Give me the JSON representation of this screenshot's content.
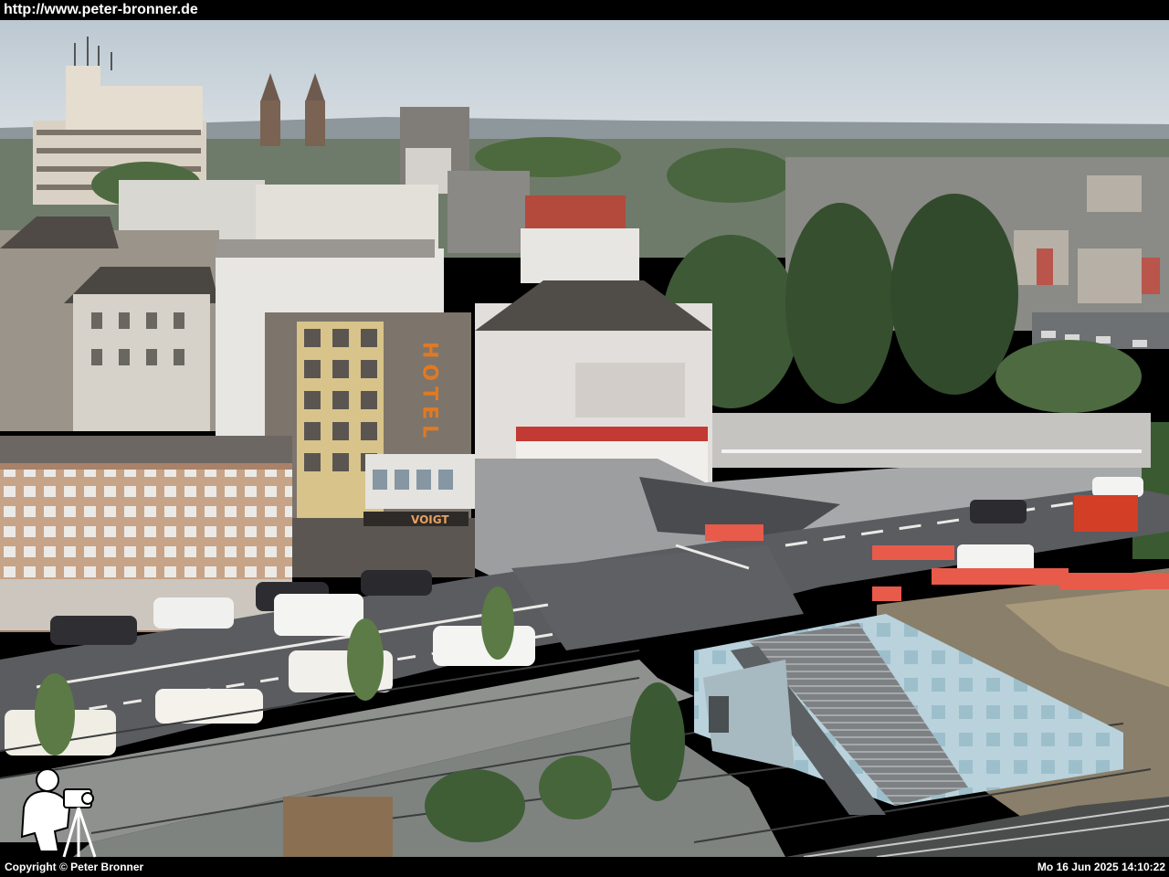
{
  "header": {
    "url_text": "http://www.peter-bronner.de"
  },
  "footer": {
    "copyright": "Copyright © Peter Bronner",
    "timestamp": "Mo 16 Jun 2025 14:10:22"
  },
  "sign": {
    "hotel": "HOTEL",
    "shop": "VOIGT"
  },
  "colors": {
    "sky": "#c9d4dc",
    "asphalt": "#5a5c60",
    "hotel_sign": "#e07a22",
    "trees": "#3f5a38"
  }
}
